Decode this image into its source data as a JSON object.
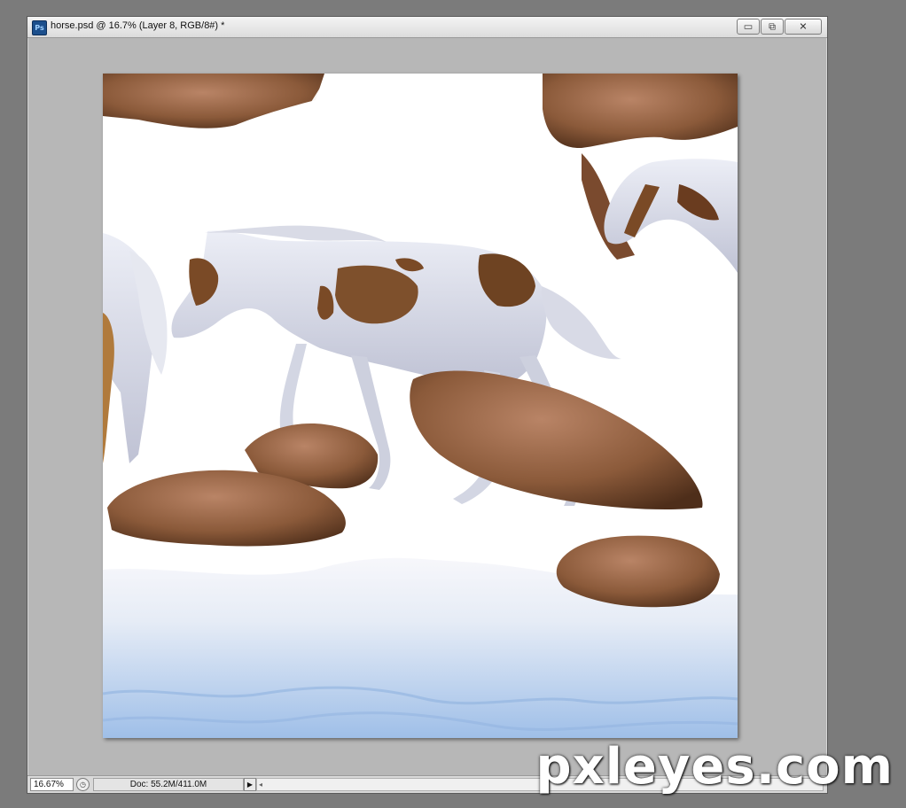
{
  "window": {
    "app_icon_label": "Ps",
    "title": "horse.psd @ 16.7% (Layer 8, RGB/8#) *",
    "minimize_label": "▭",
    "restore_label": "⧉",
    "close_label": "✕"
  },
  "statusbar": {
    "zoom": "16.67%",
    "doc_info": "Doc: 55.2M/411.0M"
  },
  "watermark": "pxleyes.com",
  "colors": {
    "canvas_bg": "#b7b7b7",
    "horse_coat": "#dcdde8",
    "horse_spots": "#7a4a26",
    "rock": "#8b5a3a",
    "water": "#a9c6ea"
  },
  "icons": {
    "app": "photoshop-icon",
    "status": "status-clock-icon",
    "menu_arrow": "triangle-right-icon"
  }
}
